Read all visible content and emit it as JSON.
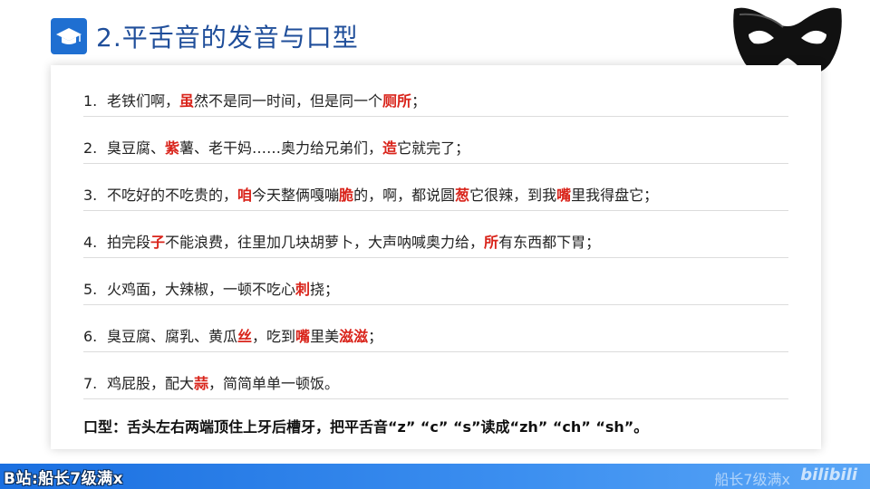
{
  "title": {
    "text": "2.平舌音的发音与口型"
  },
  "items": [
    {
      "num": "1.",
      "parts": [
        {
          "t": "老铁们啊，",
          "h": false
        },
        {
          "t": "虽",
          "h": true
        },
        {
          "t": "然不是同一时间，但是同一个",
          "h": false
        },
        {
          "t": "厕所",
          "h": true
        },
        {
          "t": "；",
          "h": false
        }
      ]
    },
    {
      "num": "2.",
      "parts": [
        {
          "t": "臭豆腐、",
          "h": false
        },
        {
          "t": "紫",
          "h": true
        },
        {
          "t": "薯、老干妈……奥力给兄弟们，",
          "h": false
        },
        {
          "t": "造",
          "h": true
        },
        {
          "t": "它就完了；",
          "h": false
        }
      ]
    },
    {
      "num": "3.",
      "parts": [
        {
          "t": "不吃好的不吃贵的，",
          "h": false
        },
        {
          "t": "咱",
          "h": true
        },
        {
          "t": "今天整俩嘎嘣",
          "h": false
        },
        {
          "t": "脆",
          "h": true
        },
        {
          "t": "的，啊，都说圆",
          "h": false
        },
        {
          "t": "葱",
          "h": true
        },
        {
          "t": "它很辣，到我",
          "h": false
        },
        {
          "t": "嘴",
          "h": true
        },
        {
          "t": "里我得盘它；",
          "h": false
        }
      ]
    },
    {
      "num": "4.",
      "parts": [
        {
          "t": "拍完段",
          "h": false
        },
        {
          "t": "子",
          "h": true
        },
        {
          "t": "不能浪费，往里加几块胡萝卜，大声呐喊奥力给，",
          "h": false
        },
        {
          "t": "所",
          "h": true
        },
        {
          "t": "有东西都下胃；",
          "h": false
        }
      ]
    },
    {
      "num": "5.",
      "parts": [
        {
          "t": "火鸡面，大辣椒，一顿不吃心",
          "h": false
        },
        {
          "t": "刺",
          "h": true
        },
        {
          "t": "挠；",
          "h": false
        }
      ]
    },
    {
      "num": "6.",
      "parts": [
        {
          "t": "臭豆腐、腐乳、黄瓜",
          "h": false
        },
        {
          "t": "丝",
          "h": true
        },
        {
          "t": "，吃到",
          "h": false
        },
        {
          "t": "嘴",
          "h": true
        },
        {
          "t": "里美",
          "h": false
        },
        {
          "t": "滋滋",
          "h": true
        },
        {
          "t": "；",
          "h": false
        }
      ]
    },
    {
      "num": "7.",
      "parts": [
        {
          "t": "鸡屁股，配大",
          "h": false
        },
        {
          "t": "蒜",
          "h": true
        },
        {
          "t": "，简简单单一顿饭。",
          "h": false
        }
      ]
    }
  ],
  "summary": "口型：舌头左右两端顶住上牙后槽牙，把平舌音“z” “c” “s”读成“zh” “ch” “sh”。",
  "footer": {
    "channel": "B站:船长7级满x",
    "watermark": "船长7级满x",
    "logo": "bilibili"
  },
  "colors": {
    "accent": "#1f6fd1",
    "highlight": "#d9241b",
    "title": "#1f4e9a"
  },
  "icons": {
    "title_icon": "graduation-cap-icon",
    "decoration": "mask-icon"
  }
}
